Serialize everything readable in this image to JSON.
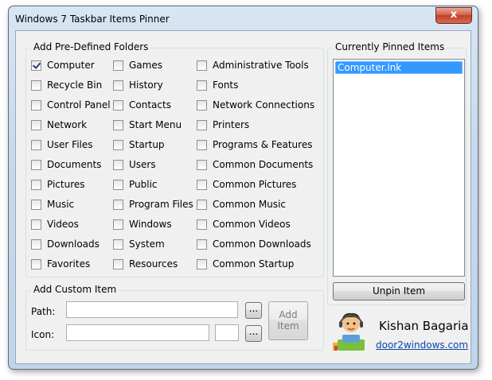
{
  "window": {
    "title": "Windows 7 Taskbar Items Pinner",
    "close_label": "x"
  },
  "predefined": {
    "label": "Add Pre-Defined Folders",
    "col1": [
      {
        "label": "Computer",
        "checked": true
      },
      {
        "label": "Recycle Bin",
        "checked": false
      },
      {
        "label": "Control Panel",
        "checked": false
      },
      {
        "label": "Network",
        "checked": false
      },
      {
        "label": "User Files",
        "checked": false
      },
      {
        "label": "Documents",
        "checked": false
      },
      {
        "label": "Pictures",
        "checked": false
      },
      {
        "label": "Music",
        "checked": false
      },
      {
        "label": "Videos",
        "checked": false
      },
      {
        "label": "Downloads",
        "checked": false
      },
      {
        "label": "Favorites",
        "checked": false
      }
    ],
    "col2": [
      {
        "label": "Games",
        "checked": false
      },
      {
        "label": "History",
        "checked": false
      },
      {
        "label": "Contacts",
        "checked": false
      },
      {
        "label": "Start Menu",
        "checked": false
      },
      {
        "label": "Startup",
        "checked": false
      },
      {
        "label": "Users",
        "checked": false
      },
      {
        "label": "Public",
        "checked": false
      },
      {
        "label": "Program Files",
        "checked": false
      },
      {
        "label": "Windows",
        "checked": false
      },
      {
        "label": "System",
        "checked": false
      },
      {
        "label": "Resources",
        "checked": false
      }
    ],
    "col3": [
      {
        "label": "Administrative Tools",
        "checked": false
      },
      {
        "label": "Fonts",
        "checked": false
      },
      {
        "label": "Network Connections",
        "checked": false
      },
      {
        "label": "Printers",
        "checked": false
      },
      {
        "label": "Programs & Features",
        "checked": false
      },
      {
        "label": "Common Documents",
        "checked": false
      },
      {
        "label": "Common Pictures",
        "checked": false
      },
      {
        "label": "Common Music",
        "checked": false
      },
      {
        "label": "Common Videos",
        "checked": false
      },
      {
        "label": "Common Downloads",
        "checked": false
      },
      {
        "label": "Common Startup",
        "checked": false
      }
    ]
  },
  "pinned": {
    "label": "Currently Pinned Items",
    "items": [
      "Computer.lnk"
    ],
    "unpin_label": "Unpin Item"
  },
  "custom": {
    "label": "Add Custom Item",
    "path_label": "Path:",
    "icon_label": "Icon:",
    "path_value": "",
    "icon_value": "",
    "icon_index": "",
    "browse_label": "...",
    "add_label_line1": "Add",
    "add_label_line2": "Item"
  },
  "author": {
    "name": "Kishan Bagaria",
    "link": "door2windows.com"
  }
}
